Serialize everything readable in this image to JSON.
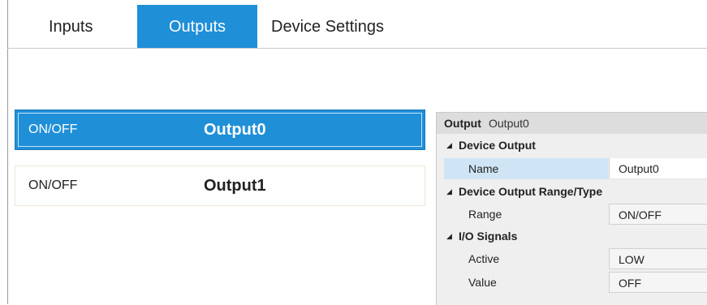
{
  "tabs": [
    {
      "label": "Inputs"
    },
    {
      "label": "Outputs"
    },
    {
      "label": "Device Settings"
    }
  ],
  "active_tab": "Outputs",
  "outputs_list": [
    {
      "type": "ON/OFF",
      "name": "Output0",
      "selected": true
    },
    {
      "type": "ON/OFF",
      "name": "Output1",
      "selected": false
    }
  ],
  "property_grid": {
    "header_bold": "Output",
    "header_name": "Output0",
    "categories": [
      {
        "label": "Device Output",
        "properties": [
          {
            "name": "Name",
            "value": "Output0"
          }
        ]
      },
      {
        "label": "Device Output Range/Type",
        "properties": [
          {
            "name": "Range",
            "value": "ON/OFF"
          }
        ]
      },
      {
        "label": "I/O Signals",
        "properties": [
          {
            "name": "Active",
            "value": "LOW"
          },
          {
            "name": "Value",
            "value": "OFF"
          }
        ]
      }
    ]
  },
  "icons": {
    "expanded": "expanded-triangle-icon"
  },
  "colors": {
    "accent": "#1f8fd8",
    "selected_property": "#cfe5f5"
  }
}
